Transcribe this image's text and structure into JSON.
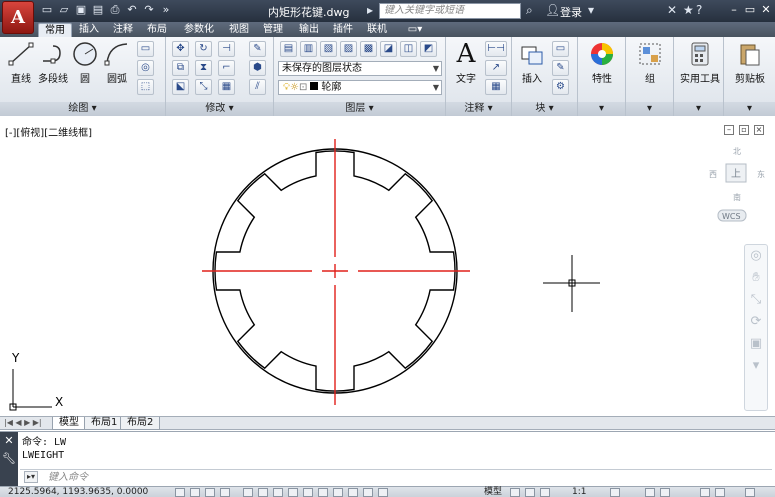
{
  "titlebar": {
    "app_glyph": "A",
    "doc_title": "内矩形花键.dwg",
    "search_placeholder": "键入关键字或短语",
    "login": "登录",
    "colors": {
      "bg": "#2e3846",
      "app_button": "#c0302a"
    }
  },
  "ribbon_tabs": [
    "常用",
    "插入",
    "注释",
    "布局",
    "参数化",
    "视图",
    "管理",
    "输出",
    "插件",
    "联机"
  ],
  "ribbon": {
    "draw": {
      "title": "绘图",
      "tools": [
        {
          "label": "直线",
          "icon": "line-icon"
        },
        {
          "label": "多段线",
          "icon": "polyline-icon"
        },
        {
          "label": "圆",
          "icon": "circle-icon"
        },
        {
          "label": "圆弧",
          "icon": "arc-icon"
        }
      ]
    },
    "modify": {
      "title": "修改"
    },
    "layers": {
      "title": "图层",
      "layer_state": "未保存的图层状态",
      "current_layer": "轮廓"
    },
    "annotation": {
      "title": "注释",
      "text_label": "文字"
    },
    "block": {
      "title": "块",
      "insert_label": "插入"
    },
    "properties": {
      "label": "特性"
    },
    "groups": {
      "label": "组"
    },
    "utilities": {
      "label": "实用工具"
    },
    "clipboard": {
      "label": "剪贴板"
    }
  },
  "viewport": {
    "label": "[-][俯视][二维线框]",
    "viewcube": {
      "north": "北",
      "south": "南",
      "west": "西",
      "east": "东",
      "face": "上",
      "ucs": "WCS"
    },
    "ucs_axes": {
      "x": "X",
      "y": "Y"
    }
  },
  "layout_tabs": [
    "模型",
    "布局1",
    "布局2"
  ],
  "command": {
    "history": [
      "命令: LW",
      "LWEIGHT"
    ],
    "placeholder": "键入命令"
  },
  "status": {
    "coords": "2125.5964, 1193.9635, 0.0000",
    "model_label": "模型",
    "scale": "1:1"
  }
}
